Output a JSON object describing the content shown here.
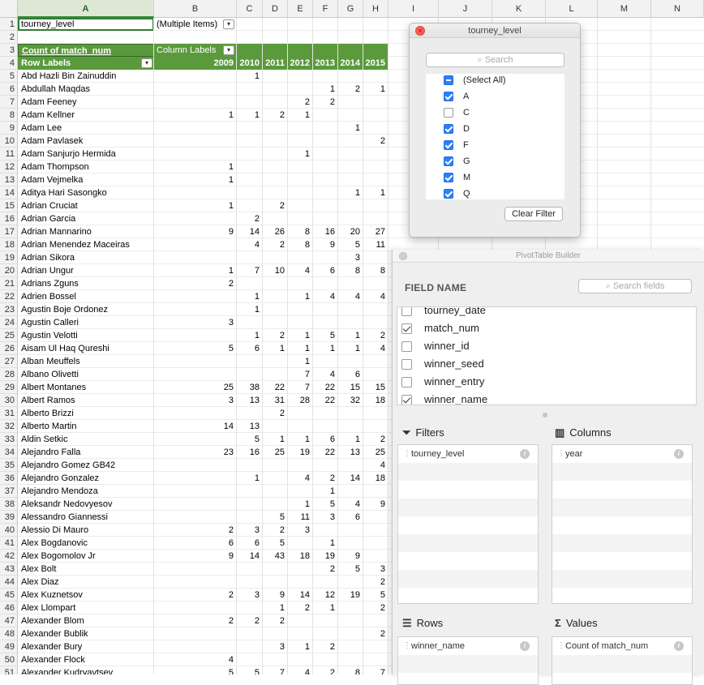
{
  "columns": [
    "A",
    "B",
    "C",
    "D",
    "E",
    "F",
    "G",
    "H",
    "I",
    "J",
    "K",
    "L",
    "M",
    "N"
  ],
  "filter": {
    "field": "tourney_level",
    "value": "(Multiple Items)"
  },
  "pivot": {
    "value_header": "Count of match_num",
    "column_labels": "Column Labels",
    "row_labels": "Row Labels",
    "years": [
      "2009",
      "2010",
      "2011",
      "2012",
      "2013",
      "2014",
      "2015"
    ],
    "rows": [
      {
        "n": "5",
        "name": "Abd Hazli Bin Zainuddin",
        "v": [
          "",
          "1",
          "",
          "",
          "",
          "",
          ""
        ]
      },
      {
        "n": "6",
        "name": "Abdullah Maqdas",
        "v": [
          "",
          "",
          "",
          "",
          "1",
          "2",
          "1"
        ]
      },
      {
        "n": "7",
        "name": "Adam Feeney",
        "v": [
          "",
          "",
          "",
          "2",
          "2",
          "",
          ""
        ]
      },
      {
        "n": "8",
        "name": "Adam Kellner",
        "v": [
          "1",
          "1",
          "2",
          "1",
          "",
          "",
          ""
        ]
      },
      {
        "n": "9",
        "name": "Adam Lee",
        "v": [
          "",
          "",
          "",
          "",
          "",
          "1",
          ""
        ]
      },
      {
        "n": "10",
        "name": "Adam Pavlasek",
        "v": [
          "",
          "",
          "",
          "",
          "",
          "",
          "2"
        ]
      },
      {
        "n": "11",
        "name": "Adam Sanjurjo Hermida",
        "v": [
          "",
          "",
          "",
          "1",
          "",
          "",
          ""
        ]
      },
      {
        "n": "12",
        "name": "Adam Thompson",
        "v": [
          "1",
          "",
          "",
          "",
          "",
          "",
          ""
        ]
      },
      {
        "n": "13",
        "name": "Adam Vejmelka",
        "v": [
          "1",
          "",
          "",
          "",
          "",
          "",
          ""
        ]
      },
      {
        "n": "14",
        "name": "Aditya Hari Sasongko",
        "v": [
          "",
          "",
          "",
          "",
          "",
          "1",
          "1"
        ]
      },
      {
        "n": "15",
        "name": "Adrian Cruciat",
        "v": [
          "1",
          "",
          "2",
          "",
          "",
          "",
          ""
        ]
      },
      {
        "n": "16",
        "name": "Adrian Garcia",
        "v": [
          "",
          "2",
          "",
          "",
          "",
          "",
          ""
        ]
      },
      {
        "n": "17",
        "name": "Adrian Mannarino",
        "v": [
          "9",
          "14",
          "26",
          "8",
          "16",
          "20",
          "27"
        ]
      },
      {
        "n": "18",
        "name": "Adrian Menendez Maceiras",
        "v": [
          "",
          "4",
          "2",
          "8",
          "9",
          "5",
          "11"
        ]
      },
      {
        "n": "19",
        "name": "Adrian Sikora",
        "v": [
          "",
          "",
          "",
          "",
          "",
          "3",
          ""
        ]
      },
      {
        "n": "20",
        "name": "Adrian Ungur",
        "v": [
          "1",
          "7",
          "10",
          "4",
          "6",
          "8",
          "8"
        ]
      },
      {
        "n": "21",
        "name": "Adrians Zguns",
        "v": [
          "2",
          "",
          "",
          "",
          "",
          "",
          ""
        ]
      },
      {
        "n": "22",
        "name": "Adrien Bossel",
        "v": [
          "",
          "1",
          "",
          "1",
          "4",
          "4",
          "4"
        ]
      },
      {
        "n": "23",
        "name": "Agustin Boje Ordonez",
        "v": [
          "",
          "1",
          "",
          "",
          "",
          "",
          ""
        ]
      },
      {
        "n": "24",
        "name": "Agustin Calleri",
        "v": [
          "3",
          "",
          "",
          "",
          "",
          "",
          ""
        ]
      },
      {
        "n": "25",
        "name": "Agustin Velotti",
        "v": [
          "",
          "1",
          "2",
          "1",
          "5",
          "1",
          "2"
        ]
      },
      {
        "n": "26",
        "name": "Aisam Ul Haq Qureshi",
        "v": [
          "5",
          "6",
          "1",
          "1",
          "1",
          "1",
          "4"
        ]
      },
      {
        "n": "27",
        "name": "Alban Meuffels",
        "v": [
          "",
          "",
          "",
          "1",
          "",
          "",
          ""
        ]
      },
      {
        "n": "28",
        "name": "Albano Olivetti",
        "v": [
          "",
          "",
          "",
          "7",
          "4",
          "6",
          ""
        ]
      },
      {
        "n": "29",
        "name": "Albert Montanes",
        "v": [
          "25",
          "38",
          "22",
          "7",
          "22",
          "15",
          "15"
        ]
      },
      {
        "n": "30",
        "name": "Albert Ramos",
        "v": [
          "3",
          "13",
          "31",
          "28",
          "22",
          "32",
          "18"
        ]
      },
      {
        "n": "31",
        "name": "Alberto Brizzi",
        "v": [
          "",
          "",
          "2",
          "",
          "",
          "",
          ""
        ]
      },
      {
        "n": "32",
        "name": "Alberto Martin",
        "v": [
          "14",
          "13",
          "",
          "",
          "",
          "",
          ""
        ]
      },
      {
        "n": "33",
        "name": "Aldin Setkic",
        "v": [
          "",
          "5",
          "1",
          "1",
          "6",
          "1",
          "2"
        ]
      },
      {
        "n": "34",
        "name": "Alejandro Falla",
        "v": [
          "23",
          "16",
          "25",
          "19",
          "22",
          "13",
          "25"
        ]
      },
      {
        "n": "35",
        "name": "Alejandro Gomez GB42",
        "v": [
          "",
          "",
          "",
          "",
          "",
          "",
          "4"
        ]
      },
      {
        "n": "36",
        "name": "Alejandro Gonzalez",
        "v": [
          "",
          "1",
          "",
          "4",
          "2",
          "14",
          "18"
        ]
      },
      {
        "n": "37",
        "name": "Alejandro Mendoza",
        "v": [
          "",
          "",
          "",
          "",
          "1",
          "",
          ""
        ]
      },
      {
        "n": "38",
        "name": "Aleksandr Nedovyesov",
        "v": [
          "",
          "",
          "",
          "1",
          "5",
          "4",
          "9"
        ]
      },
      {
        "n": "39",
        "name": "Alessandro Giannessi",
        "v": [
          "",
          "",
          "5",
          "11",
          "3",
          "6",
          ""
        ]
      },
      {
        "n": "40",
        "name": "Alessio Di Mauro",
        "v": [
          "2",
          "3",
          "2",
          "3",
          "",
          "",
          ""
        ]
      },
      {
        "n": "41",
        "name": "Alex Bogdanovic",
        "v": [
          "6",
          "6",
          "5",
          "",
          "1",
          "",
          ""
        ]
      },
      {
        "n": "42",
        "name": "Alex Bogomolov Jr",
        "v": [
          "9",
          "14",
          "43",
          "18",
          "19",
          "9",
          ""
        ]
      },
      {
        "n": "43",
        "name": "Alex Bolt",
        "v": [
          "",
          "",
          "",
          "",
          "2",
          "5",
          "3"
        ]
      },
      {
        "n": "44",
        "name": "Alex Diaz",
        "v": [
          "",
          "",
          "",
          "",
          "",
          "",
          "2"
        ]
      },
      {
        "n": "45",
        "name": "Alex Kuznetsov",
        "v": [
          "2",
          "3",
          "9",
          "14",
          "12",
          "19",
          "5"
        ]
      },
      {
        "n": "46",
        "name": "Alex Llompart",
        "v": [
          "",
          "",
          "1",
          "2",
          "1",
          "",
          "2"
        ]
      },
      {
        "n": "47",
        "name": "Alexander Blom",
        "v": [
          "2",
          "2",
          "2",
          "",
          "",
          "",
          ""
        ]
      },
      {
        "n": "48",
        "name": "Alexander Bublik",
        "v": [
          "",
          "",
          "",
          "",
          "",
          "",
          "2"
        ]
      },
      {
        "n": "49",
        "name": "Alexander Bury",
        "v": [
          "",
          "",
          "3",
          "1",
          "2",
          "",
          ""
        ]
      },
      {
        "n": "50",
        "name": "Alexander Flock",
        "v": [
          "4",
          "",
          "",
          "",
          "",
          "",
          ""
        ]
      },
      {
        "n": "51",
        "name": "Alexander Kudryavtsev",
        "v": [
          "5",
          "5",
          "7",
          "4",
          "2",
          "8",
          "7"
        ]
      }
    ]
  },
  "filter_popup": {
    "title": "tourney_level",
    "search_placeholder": "Search",
    "options": [
      {
        "label": "(Select All)",
        "state": "mixed"
      },
      {
        "label": "A",
        "state": "on"
      },
      {
        "label": "C",
        "state": "off"
      },
      {
        "label": "D",
        "state": "on"
      },
      {
        "label": "F",
        "state": "on"
      },
      {
        "label": "G",
        "state": "on"
      },
      {
        "label": "M",
        "state": "on"
      },
      {
        "label": "Q",
        "state": "on"
      }
    ],
    "clear_label": "Clear Filter"
  },
  "builder": {
    "title": "PivotTable Builder",
    "field_name_header": "FIELD NAME",
    "search_placeholder": "Search fields",
    "fields": [
      {
        "label": "tourney_date",
        "checked": false
      },
      {
        "label": "match_num",
        "checked": true
      },
      {
        "label": "winner_id",
        "checked": false
      },
      {
        "label": "winner_seed",
        "checked": false
      },
      {
        "label": "winner_entry",
        "checked": false
      },
      {
        "label": "winner_name",
        "checked": true
      }
    ],
    "filters_label": "Filters",
    "columns_label": "Columns",
    "rows_label": "Rows",
    "values_label": "Values",
    "filters_item": "tourney_level",
    "columns_item": "year",
    "rows_item": "winner_name",
    "values_item": "Count of match_num"
  }
}
